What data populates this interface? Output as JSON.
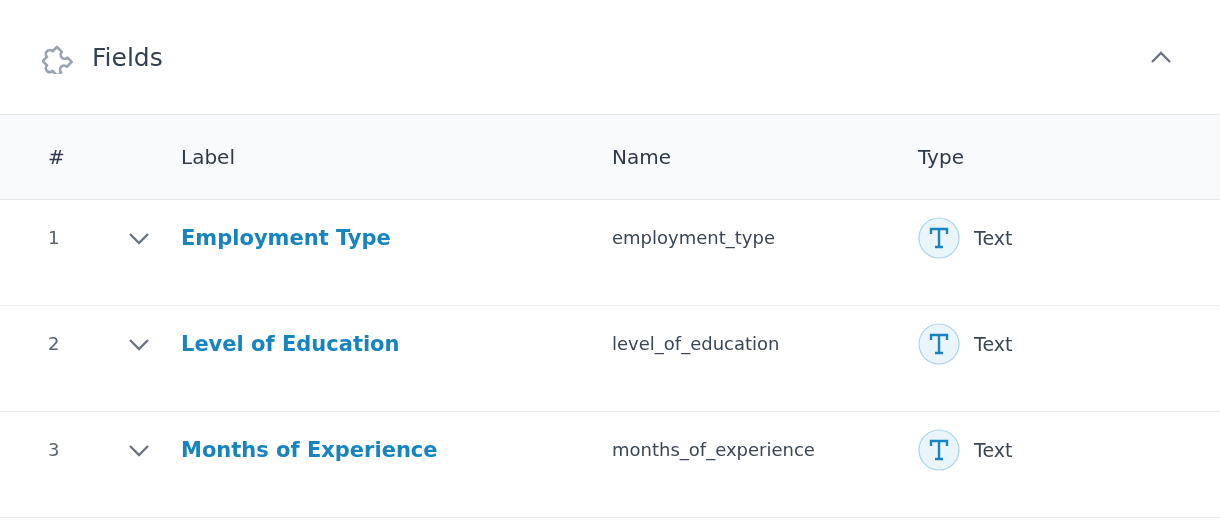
{
  "panel": {
    "title": "Fields",
    "expanded": true
  },
  "table": {
    "columns": [
      "#",
      "Label",
      "Name",
      "Type"
    ],
    "rows": [
      {
        "number": "1",
        "expanded": false,
        "label": "Employment Type",
        "name": "employment_type",
        "type": "Text",
        "kind": "text"
      },
      {
        "number": "2",
        "expanded": false,
        "label": "Level of Education",
        "name": "level_of_education",
        "type": "Text",
        "kind": "text"
      },
      {
        "number": "3",
        "expanded": false,
        "label": "Months of Experience",
        "name": "months_of_experience",
        "type": "Text",
        "kind": "text"
      }
    ]
  }
}
